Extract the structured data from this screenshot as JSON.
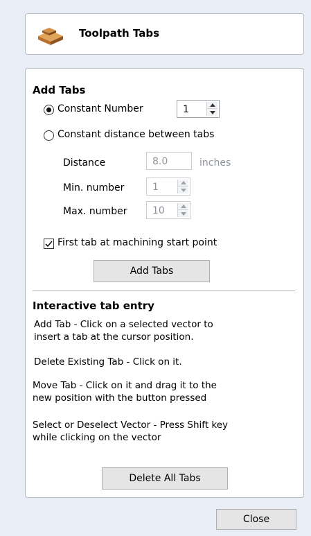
{
  "header": {
    "title": "Toolpath Tabs",
    "icon": "toolpath-tabs-icon"
  },
  "add_tabs": {
    "section_title": "Add Tabs",
    "constant_number_label": "Constant Number",
    "constant_number_value": "1",
    "constant_number_selected": true,
    "constant_distance_label": "Constant distance between tabs",
    "constant_distance_selected": false,
    "distance_label": "Distance",
    "distance_value": "8.0",
    "distance_unit": "inches",
    "min_number_label": "Min. number",
    "min_number_value": "1",
    "max_number_label": "Max. number",
    "max_number_value": "10",
    "first_tab_label": "First tab at machining start point",
    "first_tab_checked": true,
    "add_tabs_button": "Add Tabs"
  },
  "interactive": {
    "section_title": "Interactive tab entry",
    "add_tab_line1": "Add Tab - Click on a selected vector to",
    "add_tab_line2": "insert a tab at the cursor position.",
    "delete_existing": "Delete Existing Tab - Click on it.",
    "move_tab_line1": "Move Tab - Click on it and drag it to the",
    "move_tab_line2": "new position with the button pressed",
    "select_line1": "Select or Deselect Vector - Press Shift key",
    "select_line2": "while clicking on the vector",
    "delete_all_button": "Delete All Tabs"
  },
  "footer": {
    "close_button": "Close"
  }
}
